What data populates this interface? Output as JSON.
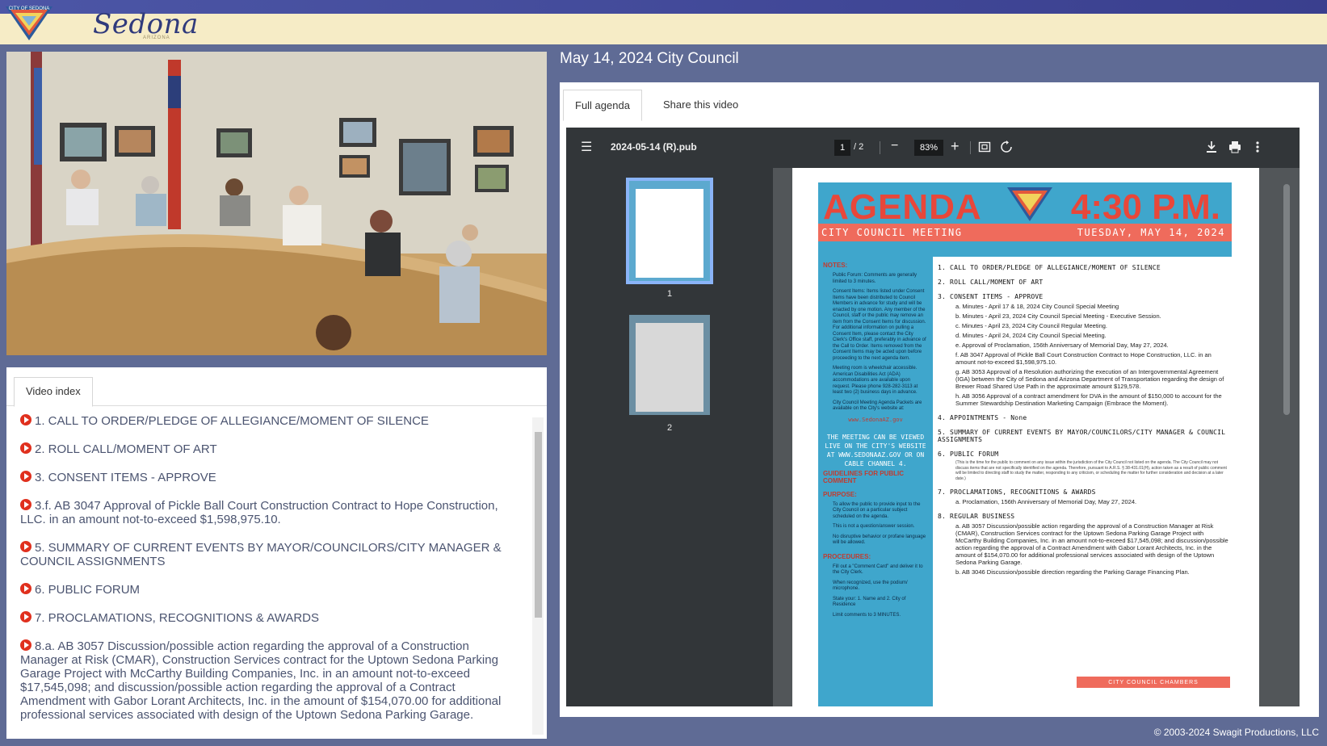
{
  "header": {
    "brand": "Sedona",
    "brand_sub": "ARIZONA",
    "logo_icon": "city-of-sedona-seal"
  },
  "video": {
    "description_icon": "council-meeting-video"
  },
  "video_index": {
    "tab_label": "Video index",
    "items": [
      "1. CALL TO ORDER/PLEDGE OF ALLEGIANCE/MOMENT OF SILENCE",
      "2. ROLL CALL/MOMENT OF ART",
      "3. CONSENT ITEMS - APPROVE",
      "3.f. AB 3047 Approval of Pickle Ball Court Construction Contract to Hope Construction, LLC. in an amount not-to-exceed $1,598,975.10.",
      "5. SUMMARY OF CURRENT EVENTS BY MAYOR/COUNCILORS/CITY MANAGER & COUNCIL ASSIGNMENTS",
      "6. PUBLIC FORUM",
      "7. PROCLAMATIONS, RECOGNITIONS & AWARDS",
      "8.a. AB 3057 Discussion/possible action regarding the approval of a Construction Manager at Risk (CMAR), Construction Services contract for the Uptown Sedona Parking Garage Project with McCarthy Building Companies, Inc. in an amount not-to-exceed $17,545,098; and discussion/possible action regarding the approval of a Contract Amendment with Gabor Lorant Architects, Inc. in the amount of $154,070.00 for additional professional services associated with design of the Uptown Sedona Parking Garage."
    ]
  },
  "meeting": {
    "title": "May 14, 2024 City Council"
  },
  "tabs": {
    "full_agenda": "Full agenda",
    "share": "Share this video"
  },
  "pdf": {
    "filename": "2024-05-14 (R).pub",
    "page_current": "1",
    "page_total": "/  2",
    "zoom": "83%",
    "thumb_labels": [
      "1",
      "2"
    ]
  },
  "agenda": {
    "word": "AGENDA",
    "time": "4:30 P.M.",
    "subtitle_left": "CITY COUNCIL MEETING",
    "subtitle_right": "TUESDAY, MAY 14, 2024",
    "notes_heading": "NOTES:",
    "notes": [
      "Public Forum: Comments are generally limited to 3 minutes.",
      "Consent Items: Items listed under Consent Items have been distributed to Council Members in advance for study and will be enacted by one motion. Any member of the Council, staff or the public may remove an item from the Consent Items for discussion. For additional information on pulling a Consent Item, please contact the City Clerk's Office staff, preferably in advance of the Call to Order. Items removed from the Consent Items may be acted upon before proceeding to the next agenda item.",
      "Meeting room is wheelchair accessible. American Disabilities Act (ADA) accommodations are available upon request. Please phone 928-282-3113 at least two (2) business days in advance.",
      "City Council Meeting Agenda Packets are available on the City's website at:"
    ],
    "site": "www.SedonaAZ.gov",
    "viewing": "THE MEETING CAN BE VIEWED LIVE ON THE CITY'S WEBSITE AT WWW.SEDONAAZ.GOV OR ON CABLE CHANNEL 4.",
    "guidelines": "GUIDELINES FOR PUBLIC COMMENT",
    "purpose_h": "PURPOSE:",
    "purpose": [
      "To allow the public to provide input to the City Council on a particular subject scheduled on the agenda.",
      "This is not a question/answer session.",
      "No disruptive behavior or profane language will be allowed."
    ],
    "procedures_h": "PROCEDURES:",
    "procedures": [
      "Fill out a \"Comment Card\" and deliver it to the City Clerk.",
      "When recognized, use the podium/ microphone.",
      "State your: 1. Name and 2. City of Residence",
      "Limit comments to 3 MINUTES."
    ],
    "items": [
      {
        "h": "1.  CALL TO ORDER/PLEDGE OF ALLEGIANCE/MOMENT OF SILENCE",
        "subs": []
      },
      {
        "h": "2.  ROLL CALL/MOMENT OF ART",
        "subs": []
      },
      {
        "h": "3.  CONSENT ITEMS - APPROVE",
        "subs": [
          "a.  Minutes - April 17 & 18, 2024 City Council Special Meeting",
          "b.  Minutes - April 23, 2024 City Council Special Meeting - Executive Session.",
          "c.  Minutes - April 23, 2024 City Council Regular Meeting.",
          "d.  Minutes - April 24, 2024 City Council Special Meeting.",
          "e.  Approval of Proclamation, 156th Anniversary of Memorial Day, May 27, 2024.",
          "f.  AB 3047 Approval of Pickle Ball Court Construction Contract to Hope Construction, LLC. in an amount not-to-exceed $1,598,975.10.",
          "g.  AB 3053 Approval of a Resolution authorizing the execution of an Intergovernmental Agreement (IGA) between the City of Sedona and Arizona Department of Transportation regarding the design of Brewer Road Shared Use Path in the approximate amount $129,578.",
          "h.  AB 3056 Approval of a contract amendment for DVA in the amount of $150,000 to account for the Summer Stewardship Destination Marketing Campaign (Embrace the Moment)."
        ]
      },
      {
        "h": "4.  APPOINTMENTS - None",
        "subs": []
      },
      {
        "h": "5.  SUMMARY OF CURRENT EVENTS BY MAYOR/COUNCILORS/CITY MANAGER & COUNCIL ASSIGNMENTS",
        "subs": []
      },
      {
        "h": "6.  PUBLIC FORUM",
        "subs": [],
        "small": "(This is the time for the public to comment on any issue within the jurisdiction of the City Council not listed on the agenda. The City Council may not discuss items that are not specifically identified on the agenda. Therefore, pursuant to A.R.S. § 38-431.01(H), action taken as a result of public comment will be limited to directing staff to study the matter, responding to any criticism, or scheduling the matter for further consideration and decision at a later date.)"
      },
      {
        "h": "7.  PROCLAMATIONS, RECOGNITIONS & AWARDS",
        "subs": [
          "a.  Proclamation, 156th Anniversary of Memorial Day, May 27, 2024."
        ]
      },
      {
        "h": "8.  REGULAR BUSINESS",
        "subs": [
          "a.  AB 3057 Discussion/possible action regarding the approval of a Construction Manager at Risk (CMAR), Construction Services contract for the Uptown Sedona Parking Garage Project with McCarthy Building Companies, Inc. in an amount not-to-exceed $17,545,098; and discussion/possible action regarding the approval of a Contract Amendment with Gabor Lorant Architects, Inc. in the amount of $154,070.00 for additional professional services associated with design of the Uptown Sedona Parking Garage.",
          "b.  AB 3046 Discussion/possible direction regarding the Parking Garage Financing Plan."
        ]
      }
    ],
    "footer": "CITY COUNCIL CHAMBERS"
  },
  "footer": {
    "copyright": "© 2003-2024 Swagit Productions, LLC"
  }
}
